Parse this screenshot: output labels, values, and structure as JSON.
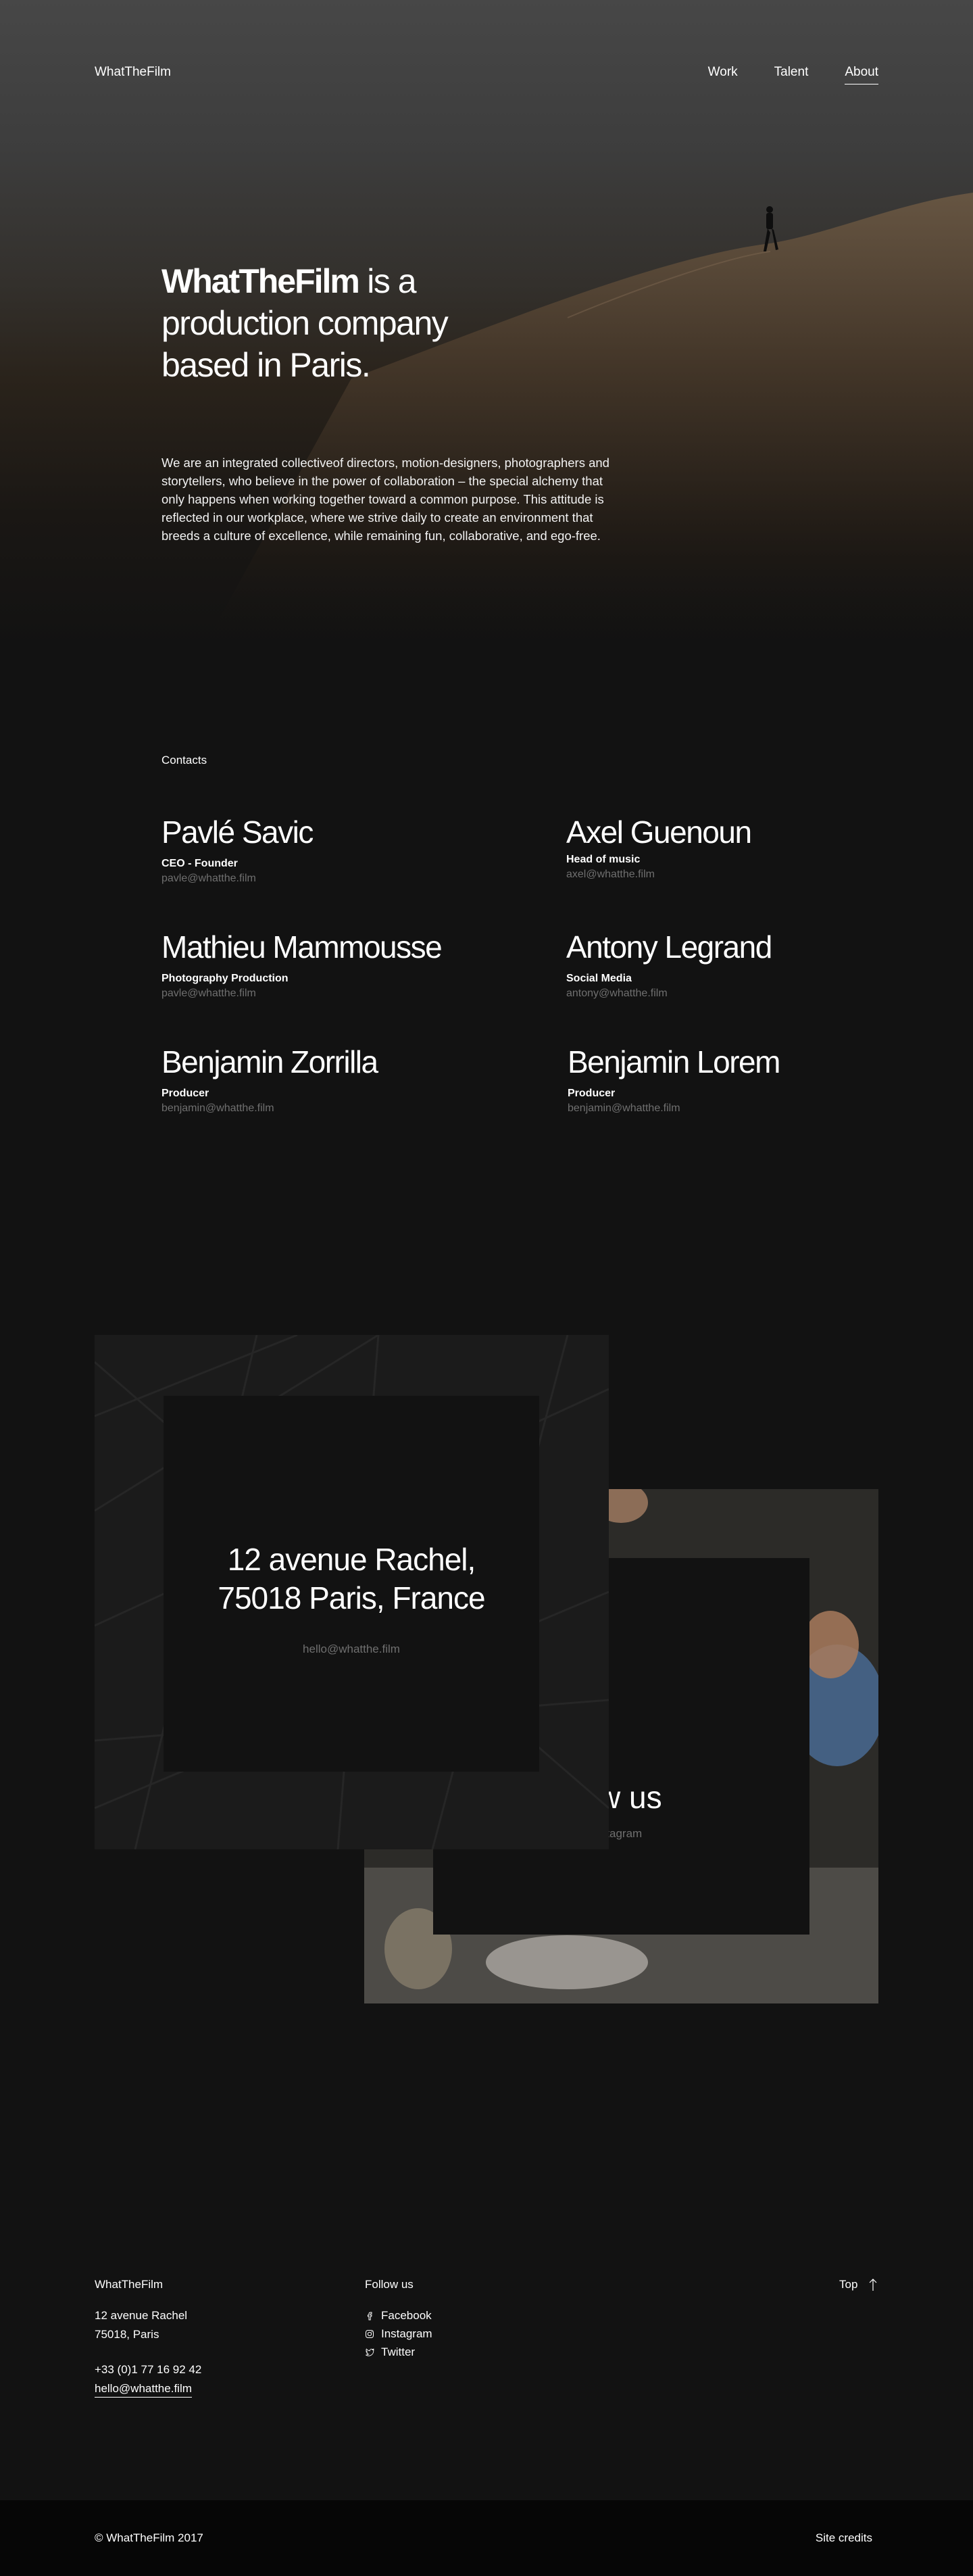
{
  "nav": {
    "logo": "WhatTheFilm",
    "items": [
      {
        "label": "Work"
      },
      {
        "label": "Talent"
      },
      {
        "label": "About"
      }
    ]
  },
  "hero": {
    "headline_bold": "WhatTheFilm",
    "headline_rest_1": " is a",
    "headline_rest_2": "production company",
    "headline_rest_3": "based in Paris.",
    "intro": "We are an integrated collectiveof directors, motion-designers, photographers and storytellers, who believe in the power of collaboration – the special alchemy that only happens when working together toward a common purpose. This attitude is reflected in our workplace, where we strive daily to create an environment that breeds a culture of excellence, while remaining fun, collaborative, and ego-free."
  },
  "contacts": {
    "label": "Contacts",
    "people": [
      {
        "name": "Pavlé Savic",
        "role": "CEO - Founder",
        "email": "pavle@whatthe.film"
      },
      {
        "name": "Axel Guenoun",
        "role": "Head of music",
        "email": "axel@whatthe.film"
      },
      {
        "name": "Mathieu Mammousse",
        "role": "Photography Production",
        "email": "pavle@whatthe.film"
      },
      {
        "name": "Antony Legrand",
        "role": "Social Media",
        "email": "antony@whatthe.film"
      },
      {
        "name": "Benjamin Zorrilla",
        "role": "Producer",
        "email": "benjamin@whatthe.film"
      },
      {
        "name": "Benjamin Lorem",
        "role": "Producer",
        "email": "benjamin@whatthe.film"
      }
    ]
  },
  "address_card": {
    "line1": "12 avenue Rachel,",
    "line2": "75018 Paris, France",
    "email": "hello@whatthe.film"
  },
  "follow_card": {
    "title": "ow us",
    "links": "stagram"
  },
  "footer": {
    "brand": "WhatTheFilm",
    "address_line1": "12 avenue Rachel",
    "address_line2": "75018, Paris",
    "phone": "+33 (0)1 77 16 92 42",
    "email": "hello@whatthe.film",
    "follow_label": "Follow us",
    "socials": [
      {
        "label": "Facebook",
        "icon": "facebook-icon"
      },
      {
        "label": "Instagram",
        "icon": "instagram-icon"
      },
      {
        "label": "Twitter",
        "icon": "twitter-icon"
      }
    ],
    "top_label": "Top",
    "copyright": "© WhatTheFilm 2017",
    "credits": "Site credits"
  }
}
